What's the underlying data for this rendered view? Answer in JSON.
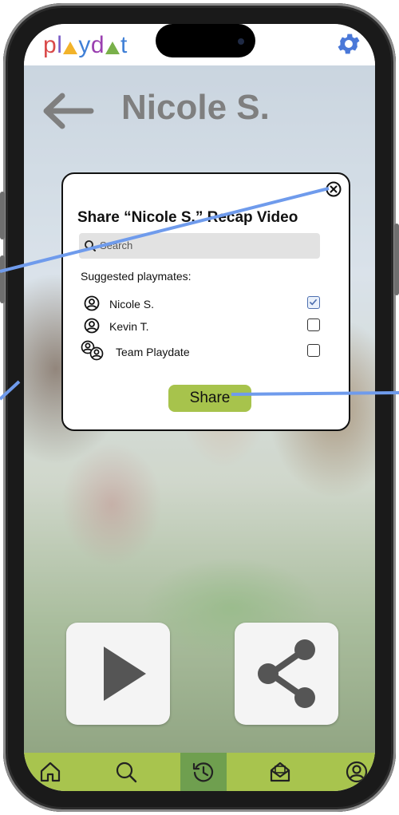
{
  "app": {
    "logo_text": "playdat",
    "logo_letters": [
      "p",
      "l",
      "a",
      "y",
      "d",
      "a",
      "t"
    ]
  },
  "header": {
    "title": "Nicole S."
  },
  "share_modal": {
    "title": "Share “Nicole S.” Recap Video",
    "search_placeholder": "Search",
    "suggested_label": "Suggested playmates:",
    "playmates": [
      {
        "name": "Nicole S.",
        "checked": true,
        "icon": "person-icon"
      },
      {
        "name": "Kevin T.",
        "checked": false,
        "icon": "person-icon"
      },
      {
        "name": "Team Playdate",
        "checked": false,
        "icon": "group-icon"
      }
    ],
    "share_label": "Share"
  },
  "tiles": {
    "play_icon": "play-icon",
    "share_icon": "share-icon"
  },
  "bottom_nav": [
    {
      "name": "home",
      "icon": "home-icon",
      "active": false
    },
    {
      "name": "search",
      "icon": "search-icon",
      "active": false
    },
    {
      "name": "history",
      "icon": "history-icon",
      "active": true
    },
    {
      "name": "inbox",
      "icon": "inbox-icon",
      "active": false
    },
    {
      "name": "profile",
      "icon": "profile-icon",
      "active": false
    }
  ],
  "colors": {
    "accent_green": "#a8c44e",
    "active_green": "#6f9f4f",
    "settings_blue": "#4a78d8",
    "annotation_blue": "#6f9bec"
  }
}
